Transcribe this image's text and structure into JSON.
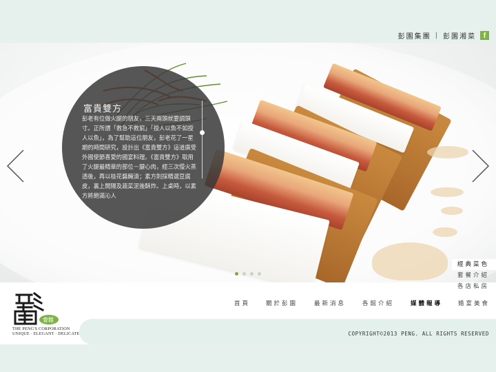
{
  "header": {
    "links": [
      "彭園集團",
      "彭園湘菜"
    ],
    "separator": "|",
    "facebook_glyph": "f"
  },
  "featured": {
    "title": "富貴雙方",
    "description": "彭老有位做火腿的朋友，三天兩頭就要調頭寸。正所謂「救急不救窮」「授人以魚不如授人以魚」，為了幫助這位朋友，彭老花了一星期的時間研究，設計出《富貴雙方》這道廣受外國使節喜愛的國宴料理。《富貴雙方》取用了火腿最精華的部位－腱心肉，經三次慢火蒸透後，再以桂花醬醃漬；素方則採精選豆腐皮，裏上開陽及蔬菜泥後酥炸。上桌時，以素方將飽滿沁人"
  },
  "carousel": {
    "dot_count": 4,
    "active_index": 0
  },
  "side_menu": {
    "items": [
      "經典菜色",
      "套餐介紹",
      "各店私房"
    ],
    "active_index": 0
  },
  "nav": {
    "items": [
      "首頁",
      "關於彭園",
      "最新消息",
      "各館介紹",
      "媒體報導",
      "婚宴美食"
    ],
    "active_index": 4
  },
  "logo": {
    "badge": "會館",
    "tagline_line1": "THE PENG'S CORPORATION",
    "tagline_line2": "UNIQUE · ELEGANT · DELICATE"
  },
  "footer": {
    "copyright": "COPYRIGHT©2013 PENG. ALL RIGHTS RESERVED"
  },
  "colors": {
    "accent_green": "#7cb342",
    "pale_mint": "#e6f1ee",
    "circle_overlay": "#3a3a3a"
  },
  "icons": {
    "facebook": "facebook-icon",
    "prev": "chevron-left-icon",
    "next": "chevron-right-icon"
  }
}
